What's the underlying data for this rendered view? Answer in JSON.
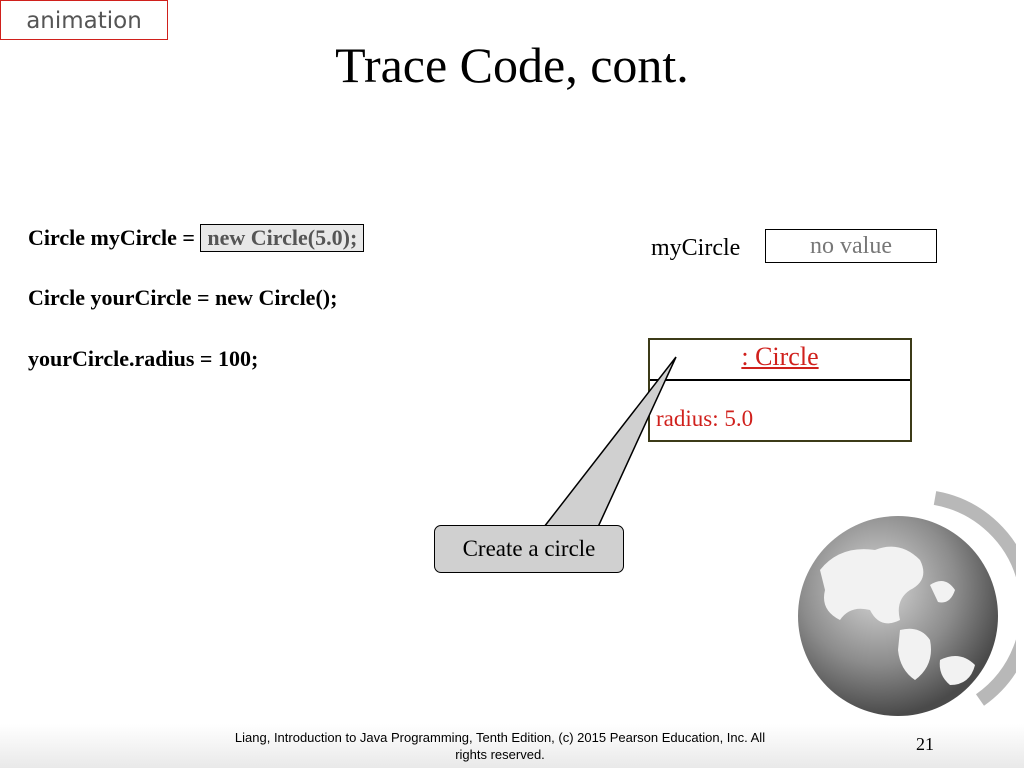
{
  "tag": {
    "label": "animation"
  },
  "title": "Trace Code, cont.",
  "code": {
    "line1_prefix": "Circle myCircle = ",
    "line1_highlight": "new Circle(5.0);",
    "line2": "Circle yourCircle = new Circle();",
    "line3": "yourCircle.radius = 100;"
  },
  "variable": {
    "name": "myCircle",
    "value": "no value"
  },
  "object": {
    "name": ": Circle",
    "field": "radius: 5.0"
  },
  "callout": {
    "label": "Create a circle"
  },
  "footer": {
    "text_line1": "Liang, Introduction to Java Programming, Tenth Edition, (c) 2015 Pearson Education, Inc. All",
    "text_line2": "rights reserved.",
    "page_number": "21"
  },
  "colors": {
    "accent_red": "#d0201c",
    "highlight_bg": "#e8e8e8",
    "callout_bg": "#d0d0d0",
    "object_border": "#3c3b18"
  },
  "icons": {
    "globe": "globe-icon"
  }
}
